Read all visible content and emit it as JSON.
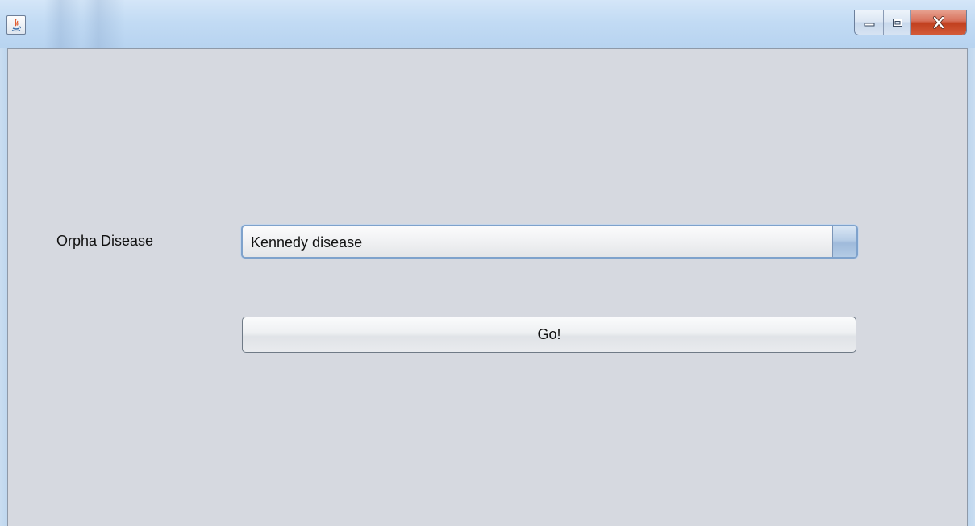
{
  "window": {
    "title": "",
    "controls": {
      "minimize_icon": "minimize-icon",
      "maximize_icon": "maximize-icon",
      "close_icon": "close-icon"
    },
    "app_icon": "java-icon"
  },
  "form": {
    "label": "Orpha Disease",
    "selected_disease": "Kennedy disease",
    "go_button_label": "Go!"
  },
  "colors": {
    "client_background": "#d6d9e0",
    "close_button": "#c84a2a",
    "combo_focus_border": "#7ea2cc"
  }
}
